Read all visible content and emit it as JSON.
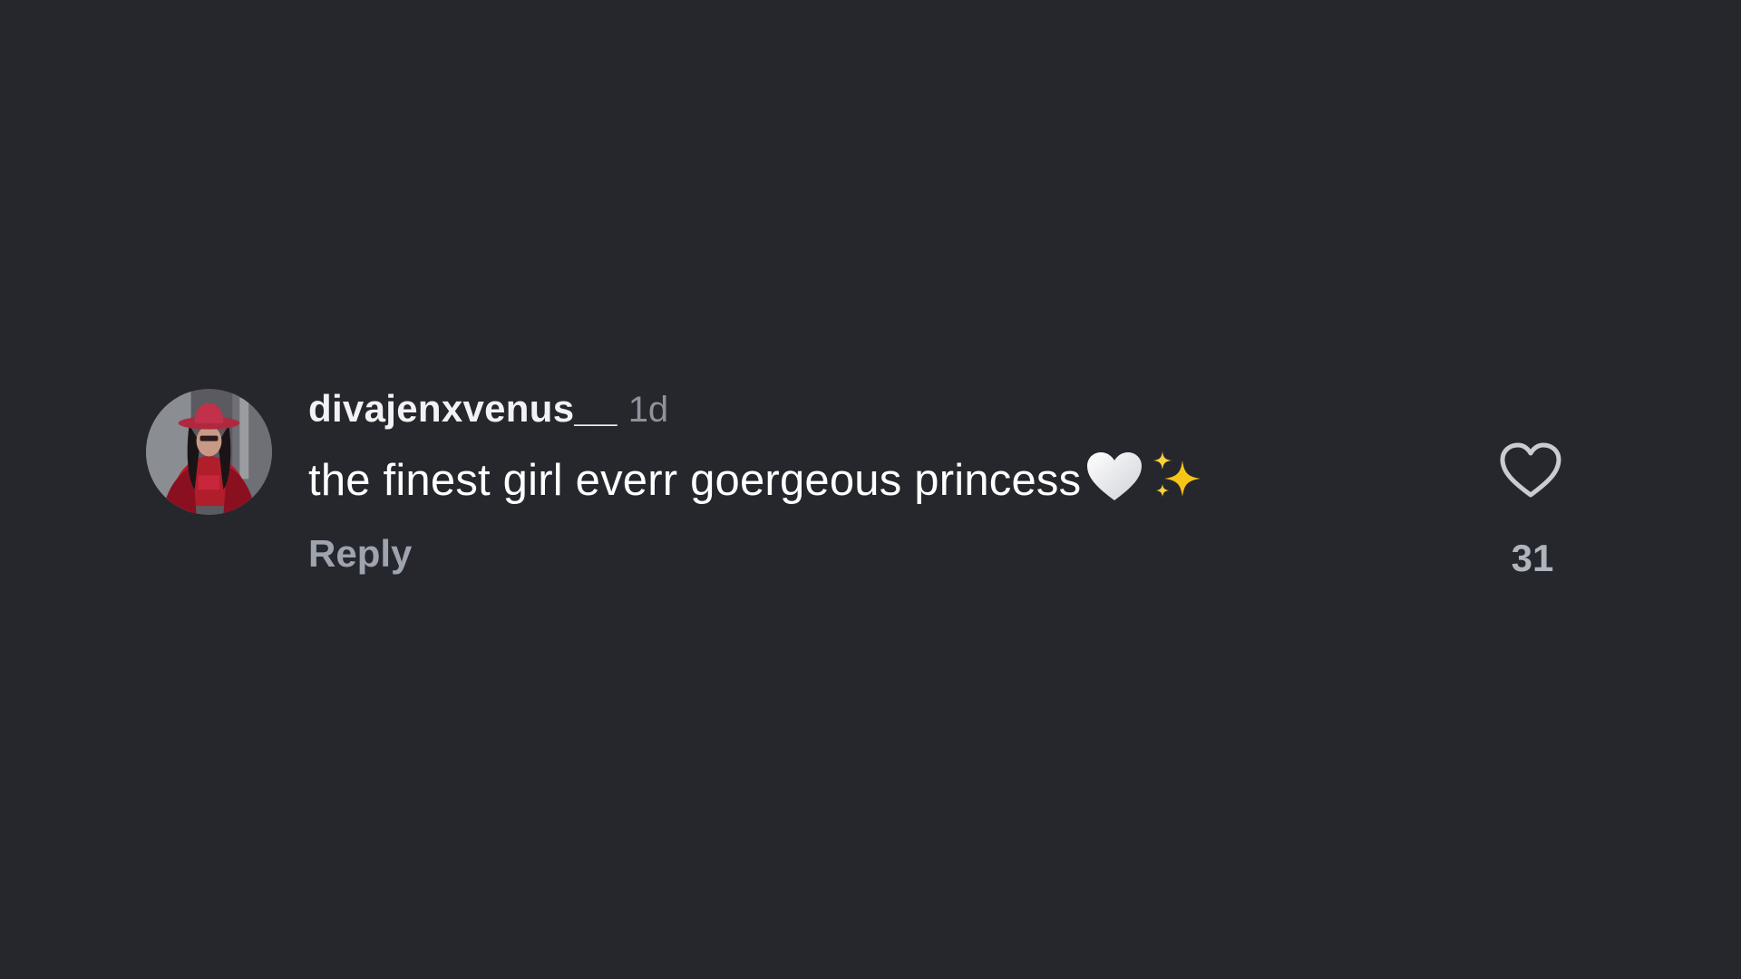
{
  "colors": {
    "background": "#25272d",
    "username": "#f2f2f4",
    "timestamp": "#8e929d",
    "comment_text": "#ffffff",
    "reply": "#9ea3ae",
    "like_icon": "#c9ccd3",
    "like_count": "#b0b4bd"
  },
  "comment": {
    "avatar_icon": "profile-avatar",
    "username": "divajenxvenus__",
    "timestamp": "1d",
    "text": "the finest girl everr goergeous princess",
    "emojis": [
      "white-heart-emoji",
      "sparkles-emoji"
    ],
    "reply_label": "Reply",
    "like_icon": "heart-outline-icon",
    "like_count": "31"
  }
}
